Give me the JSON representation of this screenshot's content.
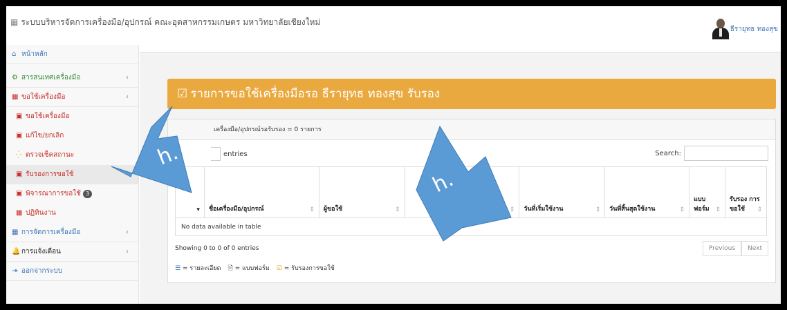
{
  "app": {
    "title": "ระบบบริหารจัดการเครื่องมือ/อุปกรณ์ คณะอุตสาหกรรมเกษตร มหาวิทยาลัยเชียงใหม่",
    "user_name": "ธีรายุทธ ทองสุข"
  },
  "sidebar": {
    "home": "หน้าหลัก",
    "items": [
      {
        "label": "สารสนเทศเครื่องมือ"
      },
      {
        "label": "ขอใช้เครื่องมือ"
      },
      {
        "label": "ขอใช้เครื่องมือ"
      },
      {
        "label": "แก้ไข/ยกเลิก"
      },
      {
        "label": "ตรวจเช็คสถานะ"
      },
      {
        "label": "รับรองการขอใช้"
      },
      {
        "label": "พิจารณาการขอใช้",
        "badge": "3"
      },
      {
        "label": "ปฏิทินงาน"
      },
      {
        "label": "การจัดการเครื่องมือ"
      },
      {
        "label": "การแจ้งเตือน"
      },
      {
        "label": "ออกจากระบบ"
      }
    ]
  },
  "main": {
    "heading": "รายการขอใช้เครื่องมือรอ ธีรายุทธ ทองสุข รับรอง",
    "panel_title": "เครื่องมือ/อุปกรณ์รอรับรอง = 0 รายการ",
    "entries_label": "entries",
    "search_label": "Search:",
    "columns": [
      "ชื่อเครื่องมือ/อุปกรณ์",
      "ผู้ขอใช้",
      "วันที่เริ่มใช้งาน",
      "วันที่สิ้นสุดใช้งาน",
      "แบบ ฟอร์ม",
      "รับรอง การ ขอใช้"
    ],
    "empty_text": "No data available in table",
    "info_text": "Showing 0 to 0 of 0 entries",
    "pager": {
      "previous": "Previous",
      "next": "Next"
    },
    "legend": {
      "detail": "= รายละเอียด",
      "form": "= แบบฟอร์ม",
      "approve": "= รับรองการขอใช้"
    }
  },
  "annotations": {
    "arrow_label": "h."
  }
}
